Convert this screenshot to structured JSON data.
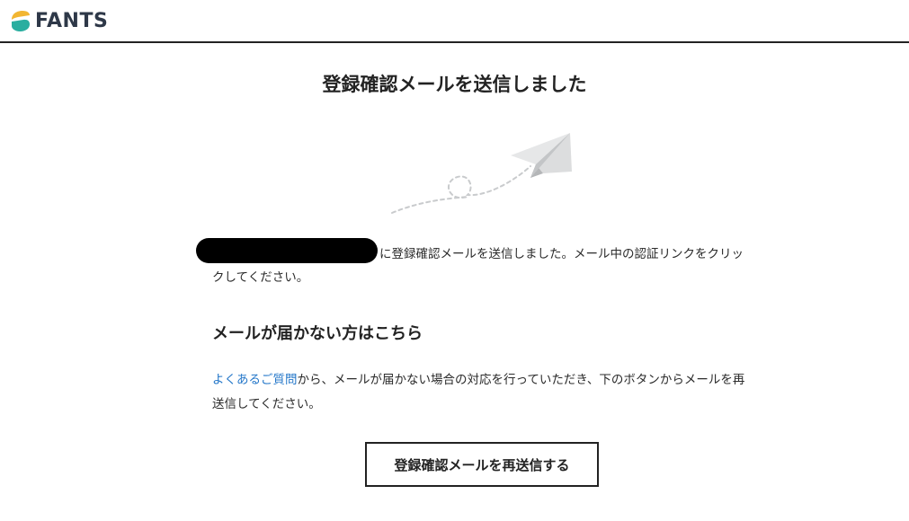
{
  "header": {
    "logo_text": "FANTS",
    "logo_colors": {
      "top": "#f2b632",
      "bottom": "#2aaea0"
    }
  },
  "main": {
    "title": "登録確認メールを送信しました",
    "notice_text": "に登録確認メールを送信しました。メール中の認証リンクをクリックしてください。",
    "subheading": "メールが届かない方はこちら",
    "help": {
      "faq_link": "よくあるご質問",
      "text": "から、メールが届かない場合の対応を行っていただき、下のボタンからメールを再送信してください。"
    },
    "resend_button": "登録確認メールを再送信する"
  },
  "colors": {
    "link": "#2477c9",
    "border": "#222222"
  }
}
